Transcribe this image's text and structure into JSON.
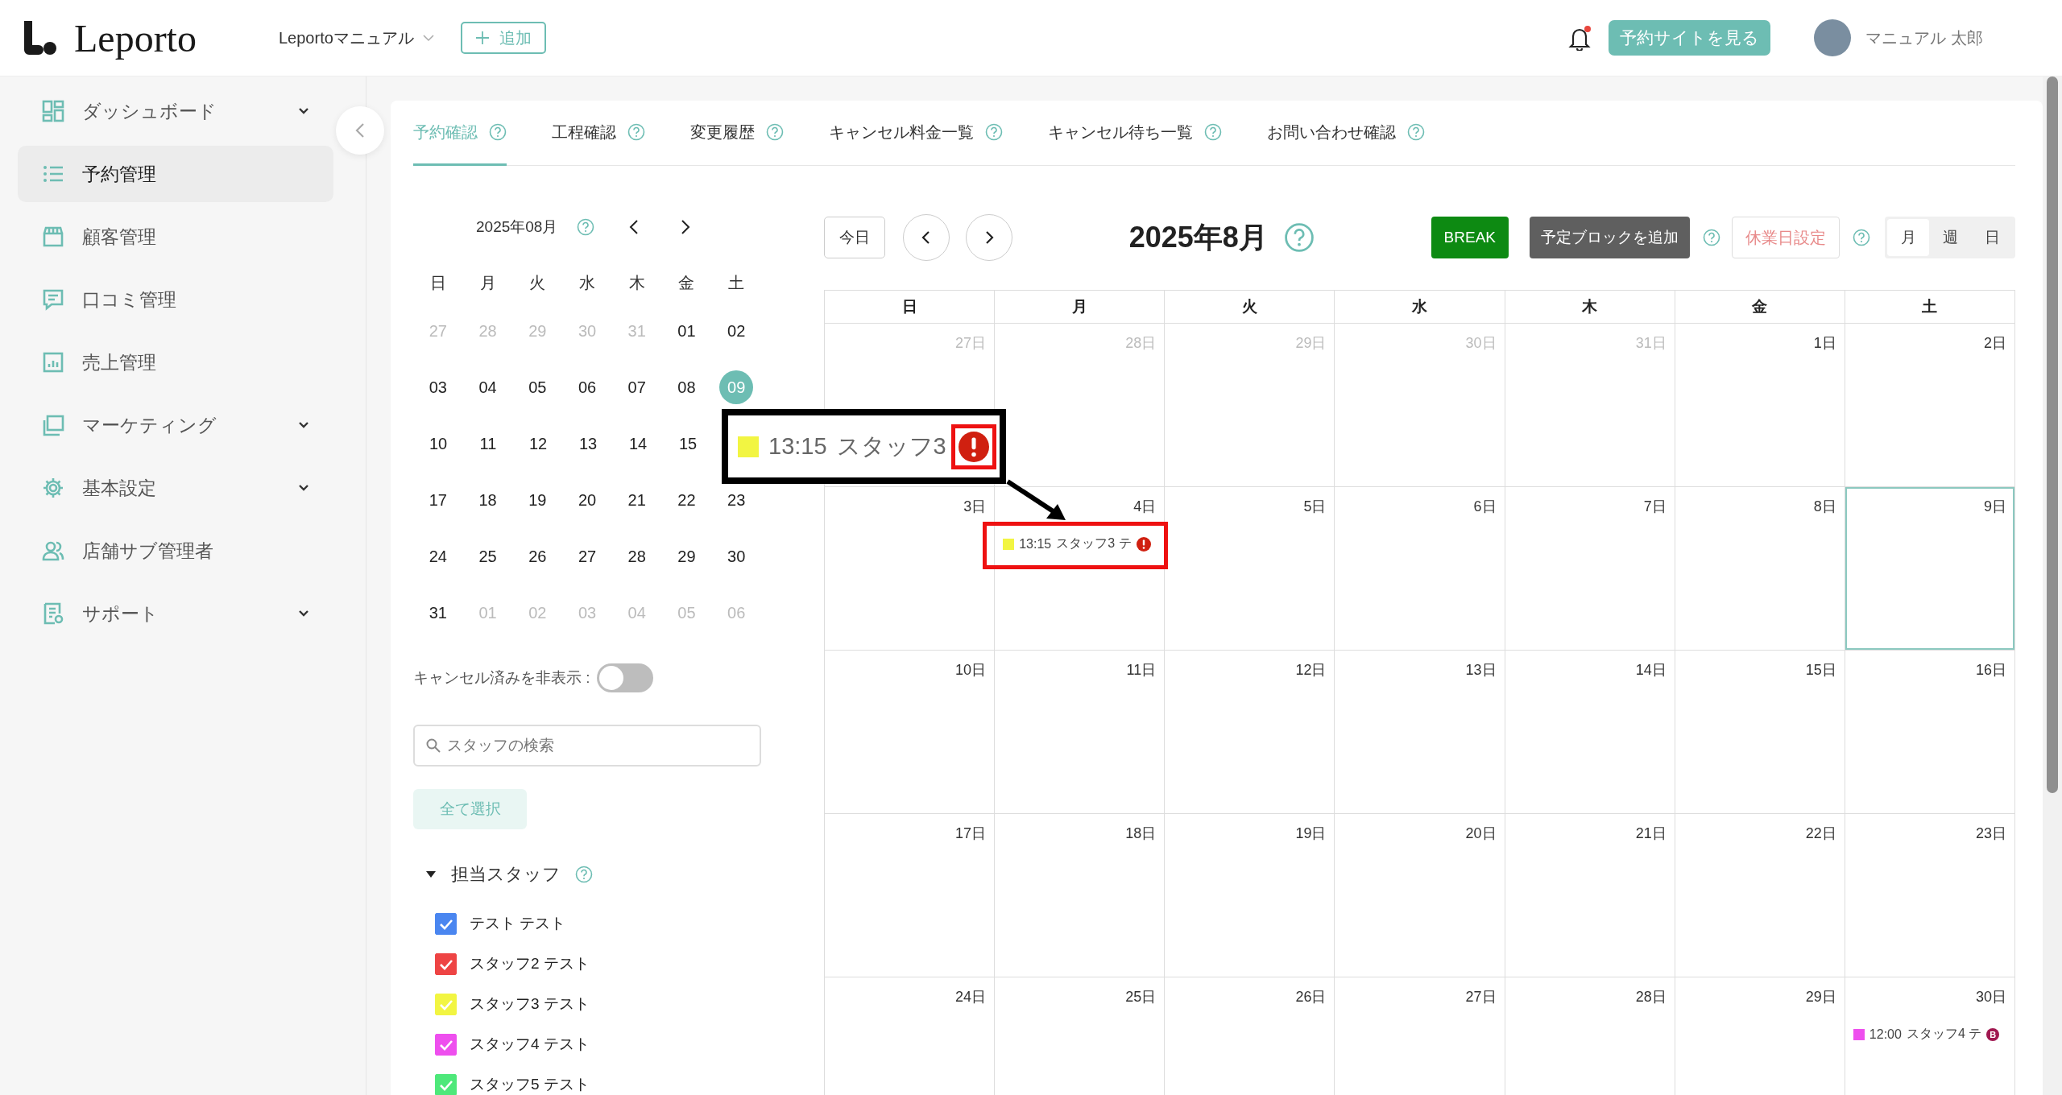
{
  "header": {
    "logo": "Leporto",
    "store": "Leportoマニュアル",
    "add_button": "追加",
    "site_button": "予約サイトを見る",
    "user_name": "マニュアル 太郎"
  },
  "sidebar": {
    "items": [
      {
        "label": "ダッシュボード",
        "kind": "dashboard",
        "expandable": true,
        "selected": false
      },
      {
        "label": "予約管理",
        "kind": "list",
        "expandable": false,
        "selected": true
      },
      {
        "label": "顧客管理",
        "kind": "store",
        "expandable": false,
        "selected": false
      },
      {
        "label": "口コミ管理",
        "kind": "chat",
        "expandable": false,
        "selected": false
      },
      {
        "label": "売上管理",
        "kind": "chart",
        "expandable": false,
        "selected": false
      },
      {
        "label": "マーケティング",
        "kind": "window",
        "expandable": true,
        "selected": false
      },
      {
        "label": "基本設定",
        "kind": "gear",
        "expandable": true,
        "selected": false
      },
      {
        "label": "店舗サブ管理者",
        "kind": "users",
        "expandable": false,
        "selected": false
      },
      {
        "label": "サポート",
        "kind": "document",
        "expandable": true,
        "selected": false
      }
    ]
  },
  "tabs": [
    {
      "label": "予約確認",
      "selected": true
    },
    {
      "label": "工程確認",
      "selected": false
    },
    {
      "label": "変更履歴",
      "selected": false
    },
    {
      "label": "キャンセル料金一覧",
      "selected": false
    },
    {
      "label": "キャンセル待ち一覧",
      "selected": false
    },
    {
      "label": "お問い合わせ確認",
      "selected": false
    }
  ],
  "mini_calendar": {
    "title": "2025年08月",
    "weekdays": [
      "日",
      "月",
      "火",
      "水",
      "木",
      "金",
      "土"
    ],
    "weeks": [
      [
        {
          "day": "27",
          "muted": true,
          "selected": false
        },
        {
          "day": "28",
          "muted": true,
          "selected": false
        },
        {
          "day": "29",
          "muted": true,
          "selected": false
        },
        {
          "day": "30",
          "muted": true,
          "selected": false
        },
        {
          "day": "31",
          "muted": true,
          "selected": false
        },
        {
          "day": "01",
          "muted": false,
          "selected": false
        },
        {
          "day": "02",
          "muted": false,
          "selected": false
        }
      ],
      [
        {
          "day": "03",
          "muted": false,
          "selected": false
        },
        {
          "day": "04",
          "muted": false,
          "selected": false
        },
        {
          "day": "05",
          "muted": false,
          "selected": false
        },
        {
          "day": "06",
          "muted": false,
          "selected": false
        },
        {
          "day": "07",
          "muted": false,
          "selected": false
        },
        {
          "day": "08",
          "muted": false,
          "selected": false
        },
        {
          "day": "09",
          "muted": false,
          "selected": true
        }
      ],
      [
        {
          "day": "10",
          "muted": false,
          "selected": false
        },
        {
          "day": "11",
          "muted": false,
          "selected": false
        },
        {
          "day": "12",
          "muted": false,
          "selected": false
        },
        {
          "day": "13",
          "muted": false,
          "selected": false
        },
        {
          "day": "14",
          "muted": false,
          "selected": false
        },
        {
          "day": "15",
          "muted": false,
          "selected": false
        }
      ],
      [
        {
          "day": "17",
          "muted": false,
          "selected": false
        },
        {
          "day": "18",
          "muted": false,
          "selected": false
        },
        {
          "day": "19",
          "muted": false,
          "selected": false
        },
        {
          "day": "20",
          "muted": false,
          "selected": false
        },
        {
          "day": "21",
          "muted": false,
          "selected": false
        },
        {
          "day": "22",
          "muted": false,
          "selected": false
        },
        {
          "day": "23",
          "muted": false,
          "selected": false
        }
      ],
      [
        {
          "day": "24",
          "muted": false,
          "selected": false
        },
        {
          "day": "25",
          "muted": false,
          "selected": false
        },
        {
          "day": "26",
          "muted": false,
          "selected": false
        },
        {
          "day": "27",
          "muted": false,
          "selected": false
        },
        {
          "day": "28",
          "muted": false,
          "selected": false
        },
        {
          "day": "29",
          "muted": false,
          "selected": false
        },
        {
          "day": "30",
          "muted": false,
          "selected": false
        }
      ],
      [
        {
          "day": "31",
          "muted": false,
          "selected": false
        },
        {
          "day": "01",
          "muted": true,
          "selected": false
        },
        {
          "day": "02",
          "muted": true,
          "selected": false
        },
        {
          "day": "03",
          "muted": true,
          "selected": false
        },
        {
          "day": "04",
          "muted": true,
          "selected": false
        },
        {
          "day": "05",
          "muted": true,
          "selected": false
        },
        {
          "day": "06",
          "muted": true,
          "selected": false
        }
      ]
    ]
  },
  "hide_cancelled": {
    "label": "キャンセル済みを非表示 :",
    "on": false
  },
  "staff_search": {
    "placeholder": "スタッフの検索"
  },
  "select_all": "全て選択",
  "staff_group": {
    "title": "担当スタッフ",
    "expanded": true,
    "staff": [
      {
        "name": "テスト テスト",
        "color": "#4a86f0",
        "checked": true
      },
      {
        "name": "スタッフ2 テスト",
        "color": "#ee4444",
        "checked": true
      },
      {
        "name": "スタッフ3 テスト",
        "color": "#f2f542",
        "checked": true
      },
      {
        "name": "スタッフ4 テスト",
        "color": "#ee4fee",
        "checked": true
      },
      {
        "name": "スタッフ5 テスト",
        "color": "#4ee87a",
        "checked": true
      }
    ]
  },
  "calendar": {
    "today_button": "今日",
    "title": "2025年8月",
    "break_button": "BREAK",
    "block_button": "予定ブロックを追加",
    "holiday_button": "休業日設定",
    "views": [
      {
        "label": "月",
        "selected": true
      },
      {
        "label": "週",
        "selected": false
      },
      {
        "label": "日",
        "selected": false
      }
    ],
    "weekdays": [
      "日",
      "月",
      "火",
      "水",
      "木",
      "金",
      "土"
    ],
    "weeks": [
      [
        {
          "label": "27日",
          "muted": true,
          "today": false
        },
        {
          "label": "28日",
          "muted": true,
          "today": false
        },
        {
          "label": "29日",
          "muted": true,
          "today": false
        },
        {
          "label": "30日",
          "muted": true,
          "today": false
        },
        {
          "label": "31日",
          "muted": true,
          "today": false
        },
        {
          "label": "1日",
          "muted": false,
          "today": false
        },
        {
          "label": "2日",
          "muted": false,
          "today": false
        }
      ],
      [
        {
          "label": "3日",
          "muted": false,
          "today": false
        },
        {
          "label": "4日",
          "muted": false,
          "today": false,
          "events": [
            {
              "time": "13:15",
              "title": "スタッフ3 テ",
              "color": "#f2f542",
              "badge": {
                "kind": "alert"
              }
            }
          ]
        },
        {
          "label": "5日",
          "muted": false,
          "today": false
        },
        {
          "label": "6日",
          "muted": false,
          "today": false
        },
        {
          "label": "7日",
          "muted": false,
          "today": false
        },
        {
          "label": "8日",
          "muted": false,
          "today": false
        },
        {
          "label": "9日",
          "muted": false,
          "today": true
        }
      ],
      [
        {
          "label": "10日",
          "muted": false,
          "today": false
        },
        {
          "label": "11日",
          "muted": false,
          "today": false
        },
        {
          "label": "12日",
          "muted": false,
          "today": false
        },
        {
          "label": "13日",
          "muted": false,
          "today": false
        },
        {
          "label": "14日",
          "muted": false,
          "today": false
        },
        {
          "label": "15日",
          "muted": false,
          "today": false
        },
        {
          "label": "16日",
          "muted": false,
          "today": false
        }
      ],
      [
        {
          "label": "17日",
          "muted": false,
          "today": false
        },
        {
          "label": "18日",
          "muted": false,
          "today": false
        },
        {
          "label": "19日",
          "muted": false,
          "today": false
        },
        {
          "label": "20日",
          "muted": false,
          "today": false
        },
        {
          "label": "21日",
          "muted": false,
          "today": false
        },
        {
          "label": "22日",
          "muted": false,
          "today": false
        },
        {
          "label": "23日",
          "muted": false,
          "today": false
        }
      ],
      [
        {
          "label": "24日",
          "muted": false,
          "today": false
        },
        {
          "label": "25日",
          "muted": false,
          "today": false
        },
        {
          "label": "26日",
          "muted": false,
          "today": false
        },
        {
          "label": "27日",
          "muted": false,
          "today": false
        },
        {
          "label": "28日",
          "muted": false,
          "today": false
        },
        {
          "label": "29日",
          "muted": false,
          "today": false
        },
        {
          "label": "30日",
          "muted": false,
          "today": false,
          "events": [
            {
              "time": "12:00",
              "title": "スタッフ4 テ",
              "color": "#ee4fee",
              "badge": {
                "kind": "letter",
                "text": "B"
              }
            }
          ]
        }
      ]
    ]
  },
  "callout": {
    "time": "13:15",
    "label": "スタッフ3",
    "color": "#f2f542"
  }
}
